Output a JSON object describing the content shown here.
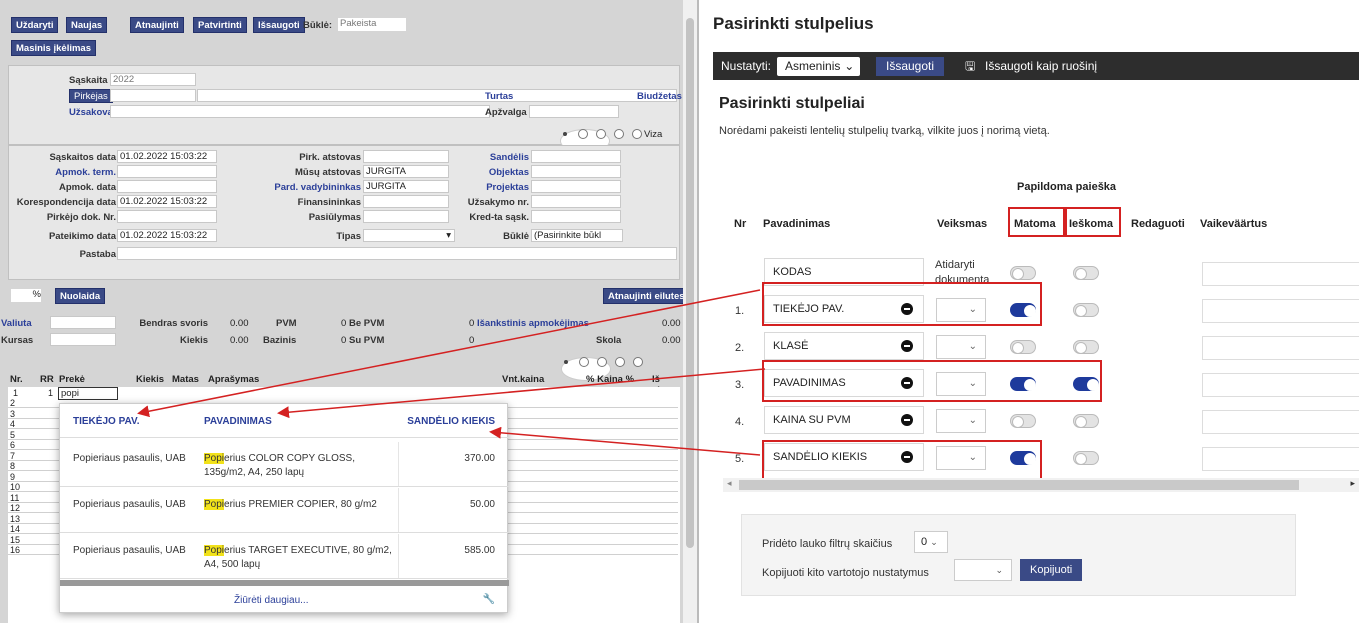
{
  "left": {
    "toolbar": [
      "Uždaryti",
      "Naujas",
      "Atnaujinti",
      "Patvirtinti",
      "Išsaugoti"
    ],
    "bukle_label": "Būklė:",
    "bukle_value": "Pakeista",
    "masinis": "Masinis įkėlimas",
    "saskaita_label": "Sąskaita",
    "saskaita_value": "2022",
    "pirkejas": "Pirkėjas",
    "uzsakovas": "Užsakovas",
    "turtas": "Turtas",
    "biudzetas": "Biudžetas",
    "apzvalga": "Apžvalga",
    "radio_label": "Viza",
    "f": {
      "saskaitos_data": "Sąskaitos data",
      "saskaitos_data_v": "01.02.2022 15:03:22",
      "apmok_term": "Apmok. term.",
      "apmok_data": "Apmok. data",
      "koresp": "Korespondencija data",
      "koresp_v": "01.02.2022 15:03:22",
      "pirk_dok": "Pirkėjo dok. Nr.",
      "pateikimo": "Pateikimo data",
      "pateikimo_v": "01.02.2022 15:03:22",
      "pastaba": "Pastaba",
      "pirk_atst": "Pirk. atstovas",
      "musu_atst": "Mūsų atstovas",
      "musu_atst_v": "JURGITA",
      "pard_vad": "Pard. vadybininkas",
      "pard_vad_v": "JURGITA",
      "finans": "Finansininkas",
      "pasiulymas": "Pasiūlymas",
      "tipas": "Tipas",
      "sandelis": "Sandėlis",
      "objektas": "Objektas",
      "projektas": "Projektas",
      "uzsakymo": "Užsakymo nr.",
      "kredta": "Kred-ta sąsk.",
      "bukle": "Būklė",
      "bukle_sel": "(Pasirinkite būkl"
    },
    "nuolaida_pct": "%",
    "nuolaida": "Nuolaida",
    "atnaujinti_eil": "Atnaujinti eilutes",
    "t": {
      "valiuta": "Valiuta",
      "kursas": "Kursas",
      "bendras_svoris": "Bendras svoris",
      "bendras_svoris_v": "0.00",
      "kiekis": "Kiekis",
      "kiekis_v": "0.00",
      "pvm": "PVM",
      "pvm_v": "0",
      "bazinis": "Bazinis",
      "bazinis_v": "0",
      "be_pvm": "Be PVM",
      "be_pvm_v": "0",
      "su_pvm": "Su PVM",
      "su_pvm_v": "0",
      "isankst": "Išankstinis apmokėjimas",
      "isankst_v": "0.00",
      "skola": "Skola",
      "skola_v": "0.00"
    },
    "grid_headers": {
      "nr": "Nr.",
      "rr": "RR",
      "preke": "Prekė",
      "kiekis": "Kiekis",
      "matas": "Matas",
      "aprasymas": "Aprašymas",
      "vnt_kaina": "Vnt.kaina",
      "kaina_pct": "% Kaina %",
      "is_visc": "Iš visc"
    },
    "first_row_nr": "1",
    "first_row_rr": "1",
    "first_row_input": "popi",
    "row_numbers": [
      "2",
      "3",
      "4",
      "5",
      "6",
      "7",
      "8",
      "9",
      "10",
      "11",
      "12",
      "13",
      "14",
      "15",
      "16"
    ],
    "popup": {
      "headers": [
        "TIEKĖJO PAV.",
        "PAVADINIMAS",
        "SANDĖLIO KIEKIS"
      ],
      "rows": [
        {
          "supplier": "Popieriaus pasaulis, UAB",
          "hl": "Popi",
          "name": "erius COLOR COPY GLOSS, 135g/m2, A4, 250 lapų",
          "qty": "370.00"
        },
        {
          "supplier": "Popieriaus pasaulis, UAB",
          "hl": "Popi",
          "name": "erius PREMIER COPIER, 80 g/m2",
          "qty": "50.00"
        },
        {
          "supplier": "Popieriaus pasaulis, UAB",
          "hl": "Popi",
          "name": "erius TARGET EXECUTIVE, 80 g/m2, A4, 500 lapų",
          "qty": "585.00"
        }
      ],
      "more": "Žiūrėti daugiau..."
    }
  },
  "right": {
    "title": "Pasirinkti stulpelius",
    "toolbar": {
      "nustatyti": "Nustatyti:",
      "preset": "Asmeninis",
      "save": "Išsaugoti",
      "save_as": "Išsaugoti kaip ruošinį"
    },
    "h2": "Pasirinkti stulpeliai",
    "desc": "Norėdami pakeisti lentelių stulpelių tvarką, vilkite juos į norimą vietą.",
    "group_header": "Papildoma paieška",
    "headers": {
      "nr": "Nr",
      "pav": "Pavadinimas",
      "veiksmas": "Veiksmas",
      "matoma": "Matoma",
      "ieskoma": "Ieškoma",
      "redaguoti": "Redaguoti",
      "vaikev": "Vaikeväärtus"
    },
    "rows": [
      {
        "nr": "",
        "name": "KODAS",
        "action": "Atidaryti dokumenta",
        "matoma": false,
        "ieskoma": false
      },
      {
        "nr": "1.",
        "name": "TIEKĖJO PAV.",
        "action": "",
        "matoma": true,
        "ieskoma": false
      },
      {
        "nr": "2.",
        "name": "KLASĖ",
        "action": "",
        "matoma": false,
        "ieskoma": false
      },
      {
        "nr": "3.",
        "name": "PAVADINIMAS",
        "action": "",
        "matoma": true,
        "ieskoma": true
      },
      {
        "nr": "4.",
        "name": "KAINA SU PVM",
        "action": "",
        "matoma": false,
        "ieskoma": false
      },
      {
        "nr": "5.",
        "name": "SANDĖLIO KIEKIS",
        "action": "",
        "matoma": true,
        "ieskoma": false
      }
    ],
    "filters_label": "Pridėto lauko filtrų skaičius",
    "filters_value": "0",
    "copy_label": "Kopijuoti kito vartotojo nustatymus",
    "copy_button": "Kopijuoti"
  },
  "colors": {
    "button_blue": "#3a4a86",
    "link_blue": "#2b3f99",
    "toggle_on": "#1e3a9c",
    "highlight_red": "#d42121",
    "toolbar_dark": "#2d2d2d"
  }
}
